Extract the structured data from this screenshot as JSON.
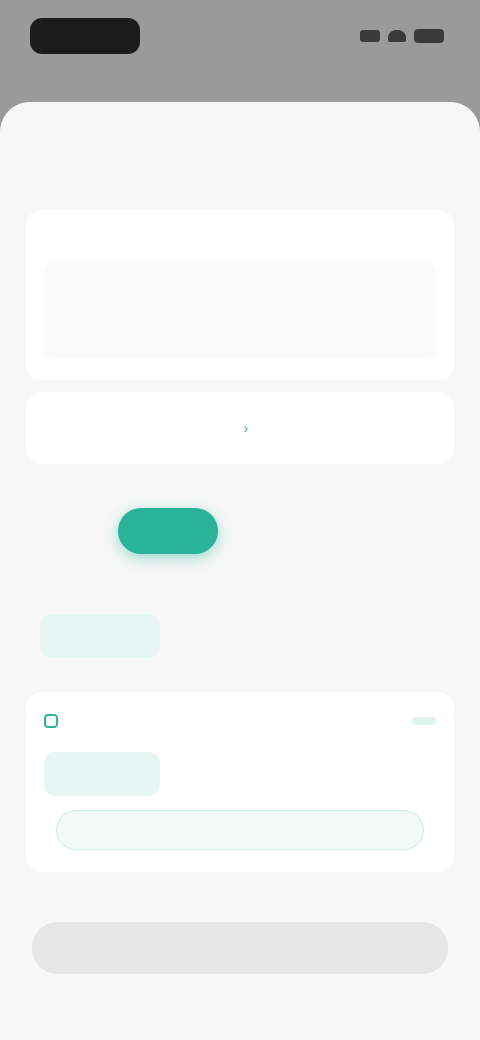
{
  "status_bar": {
    "time": "",
    "icons": [
      "signal-icon",
      "wifi-icon",
      "battery-icon"
    ]
  },
  "sheet": {
    "title": "",
    "info_card": {
      "label": "",
      "text": ""
    },
    "link_card": {
      "prefix": "",
      "link": ""
    },
    "segment": {
      "active_label": "",
      "inactive_label": ""
    },
    "options_section": {
      "label": "",
      "options": [
        {
          "label": "",
          "selected": true
        },
        {
          "label": "",
          "selected": false
        },
        {
          "label": "",
          "selected": false
        }
      ]
    },
    "time_card": {
      "label": "",
      "badge": "",
      "options": [
        {
          "label": "",
          "selected": true
        },
        {
          "label": "",
          "selected": false
        },
        {
          "label": "",
          "selected": false
        }
      ],
      "field_text": ""
    },
    "bottom_button": {
      "label": ""
    }
  },
  "colors": {
    "accent": "#2bb39a",
    "sheet_bg": "#f7f7f7",
    "overlay": "#9a9a9a"
  }
}
